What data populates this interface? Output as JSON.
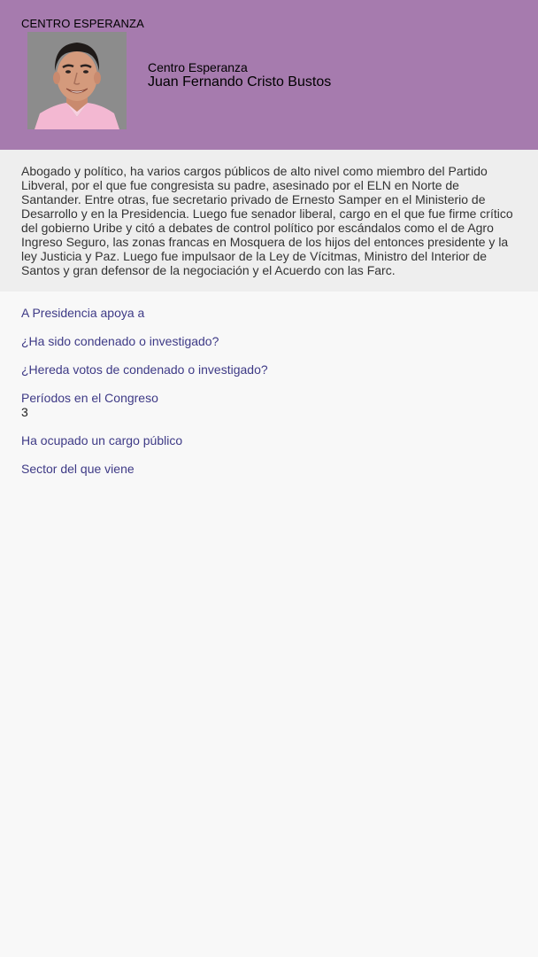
{
  "header": {
    "party_tag": "CENTRO ESPERANZA",
    "party_name": "Centro Esperanza",
    "candidate_name": "Juan Fernando Cristo Bustos",
    "header_color": "#a67bae"
  },
  "bio": {
    "text": "Abogado y político, ha varios cargos públicos de alto nivel como miembro del Partido Libveral, por el que fue congresista su padre, asesinado por el ELN en Norte de Santander. Entre otras, fue secretario privado de Ernesto Samper en el Ministerio de Desarrollo y en la Presidencia. Luego fue senador liberal, cargo en el que fue firme crítico del gobierno Uribe y citó a debates de control político por escándalos como el de Agro Ingreso Seguro, las zonas francas en Mosquera de los hijos del entonces presidente y la ley Justicia y Paz. Luego fue impulsaor de la Ley de Vícitmas, Ministro del Interior de Santos y gran defensor de la negociación y el Acuerdo con las Farc."
  },
  "questions": [
    {
      "label": "A Presidencia apoya a",
      "value": ""
    },
    {
      "label": "¿Ha sido condenado o investigado?",
      "value": ""
    },
    {
      "label": "¿Hereda votos de condenado o investigado?",
      "value": ""
    },
    {
      "label": "Períodos en el Congreso",
      "value": "3"
    },
    {
      "label": "Ha ocupado un cargo público",
      "value": ""
    },
    {
      "label": "Sector del que viene",
      "value": ""
    }
  ]
}
